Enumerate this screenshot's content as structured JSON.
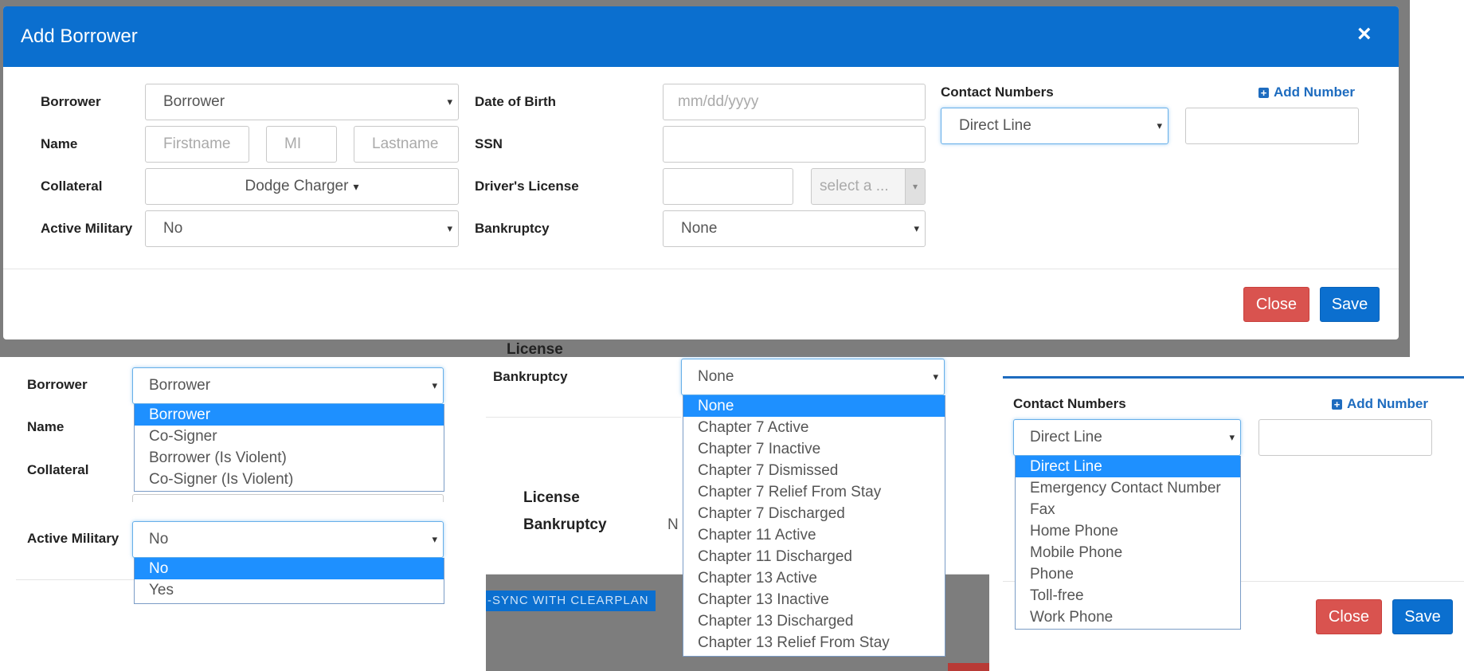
{
  "modal": {
    "title": "Add Borrower",
    "close_icon": "×",
    "labels": {
      "borrower": "Borrower",
      "name": "Name",
      "collateral": "Collateral",
      "active_military": "Active Military",
      "dob": "Date of Birth",
      "ssn": "SSN",
      "drivers_license": "Driver's License",
      "bankruptcy": "Bankruptcy",
      "contact_numbers": "Contact Numbers"
    },
    "borrower_value": "Borrower",
    "firstname_placeholder": "Firstname",
    "mi_placeholder": "MI",
    "lastname_placeholder": "Lastname",
    "collateral_value": "Dodge Charger",
    "active_military_value": "No",
    "dob_placeholder": "mm/dd/yyyy",
    "license_state_placeholder": "select a ...",
    "bankruptcy_value": "None",
    "contact_type_value": "Direct Line",
    "add_number_label": "Add Number",
    "close_button": "Close",
    "save_button": "Save"
  },
  "lower": {
    "license_text": "License",
    "license_text_2": "License",
    "bankruptcy_text_2": "Bankruptcy",
    "bankruptcy_cut_value": "N",
    "sync_badge": "-SYNC WITH CLEARPLAN",
    "borrower_label": "Borrower",
    "name_label": "Name",
    "collateral_label": "Collateral",
    "active_military_label": "Active Military",
    "bankruptcy_label": "Bankruptcy",
    "contact_numbers_label": "Contact Numbers",
    "add_number_label": "Add Number",
    "borrower_select_value": "Borrower",
    "active_military_select_value": "No",
    "bankruptcy_select_value": "None",
    "contact_select_value": "Direct Line",
    "close_button": "Close",
    "save_button": "Save",
    "borrower_options": [
      "Borrower",
      "Co-Signer",
      "Borrower (Is Violent)",
      "Co-Signer (Is Violent)"
    ],
    "military_options": [
      "No",
      "Yes"
    ],
    "bankruptcy_options": [
      "None",
      "Chapter 7 Active",
      "Chapter 7 Inactive",
      "Chapter 7 Dismissed",
      "Chapter 7 Relief From Stay",
      "Chapter 7 Discharged",
      "Chapter 11 Active",
      "Chapter 11 Discharged",
      "Chapter 13 Active",
      "Chapter 13 Inactive",
      "Chapter 13 Discharged",
      "Chapter 13 Relief From Stay"
    ],
    "contact_options": [
      "Direct Line",
      "Emergency Contact Number",
      "Fax",
      "Home Phone",
      "Mobile Phone",
      "Phone",
      "Toll-free",
      "Work Phone"
    ]
  },
  "icons": {
    "caret": "▾",
    "collateral_caret": "▾"
  },
  "colors": {
    "header_blue": "#0b6fcf",
    "selected_blue": "#1e90ff",
    "close_red": "#d9534f"
  }
}
